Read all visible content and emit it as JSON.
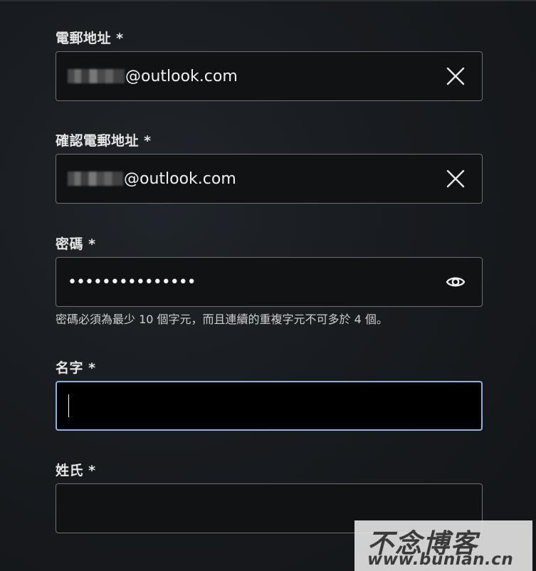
{
  "form": {
    "email": {
      "label": "電郵地址 *",
      "value_suffix": "@outlook.com",
      "clear_icon": "close-icon"
    },
    "confirm_email": {
      "label": "確認電郵地址 *",
      "value_suffix": "@outlook.com",
      "clear_icon": "close-icon"
    },
    "password": {
      "label": "密碼 *",
      "masked_value": "•••••••••••••••",
      "toggle_icon": "eye-icon",
      "hint": "密碼必須為最少 10 個字元，而且連續的重複字元不可多於 4 個。"
    },
    "first_name": {
      "label": "名字 *",
      "value": ""
    },
    "last_name": {
      "label": "姓氏 *",
      "value": ""
    }
  },
  "watermark": {
    "title": "不念博客",
    "url": "www.bunian.cn"
  },
  "colors": {
    "focus_border": "#8bb4e6",
    "input_border": "#6c6f74",
    "background": "#181b1f"
  }
}
